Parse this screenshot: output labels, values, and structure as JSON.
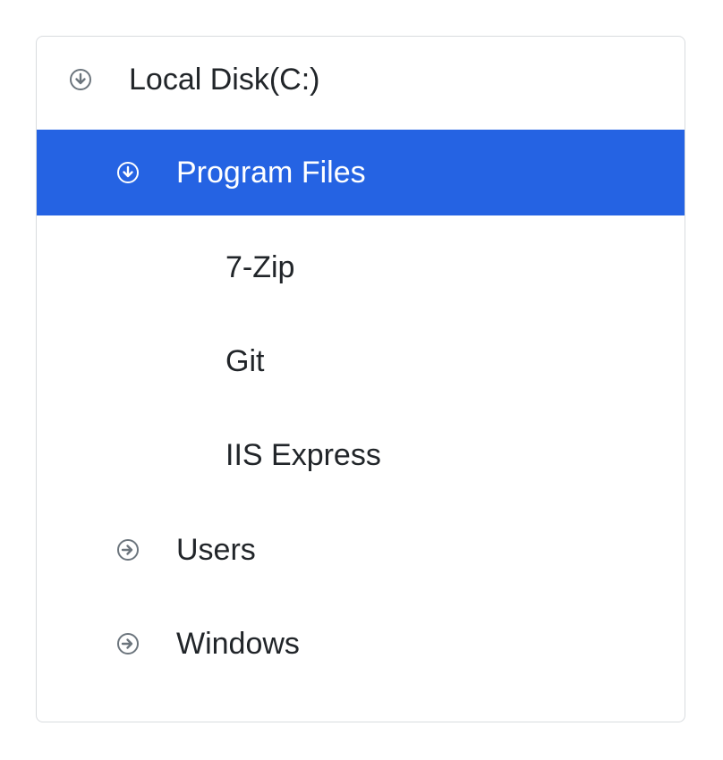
{
  "tree": {
    "items": [
      {
        "label": "Local Disk(C:)",
        "icon": "expanded-arrow-down-icon",
        "level": 0,
        "expanded": true,
        "selected": false
      },
      {
        "label": "Program Files",
        "icon": "expanded-arrow-down-icon",
        "level": 1,
        "expanded": true,
        "selected": true
      },
      {
        "label": "7-Zip",
        "icon": "",
        "level": 2,
        "selected": false
      },
      {
        "label": "Git",
        "icon": "",
        "level": 2,
        "selected": false
      },
      {
        "label": "IIS Express",
        "icon": "",
        "level": 2,
        "selected": false
      },
      {
        "label": "Users",
        "icon": "collapsed-arrow-right-icon",
        "level": 1,
        "expanded": false,
        "selected": false
      },
      {
        "label": "Windows",
        "icon": "collapsed-arrow-right-icon",
        "level": 1,
        "expanded": false,
        "selected": false
      }
    ]
  },
  "colors": {
    "selected_background": "#2563e3",
    "selected_text": "#ffffff",
    "text": "#212529",
    "icon_muted": "#6c757d",
    "border": "#d9dcdf"
  }
}
